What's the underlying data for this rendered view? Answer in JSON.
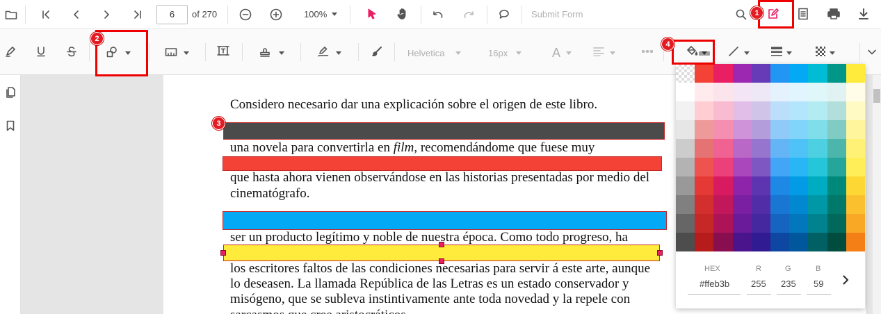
{
  "toolbar": {
    "page_number": "6",
    "page_count": "of 270",
    "zoom": "100%",
    "submit_form": "Submit Form"
  },
  "format_toolbar": {
    "font_family": "Helvetica",
    "font_size": "16px",
    "text_glyph": "A"
  },
  "callouts": [
    "1",
    "2",
    "3",
    "4"
  ],
  "document": {
    "lines": [
      "Considero necesario dar una explicación sobre el origen de este libro.",
      "una novela para convertirla en",
      "film",
      ", recomendándome que fuese muy",
      "que hasta ahora vienen observándose en las historias presentadas por medio del",
      "cinematógrafo.",
      "ser un producto legítimo y noble de nuestra época. Como todo progreso, ha",
      "los escritores faltos de las condiciones necesarias para servir á este arte, aunque",
      "lo deseasen. La llamada República de las Letras es un estado conservador y",
      "misógeno, que se subleva instintivamente ante toda novedad y la repele con",
      "sarcasmos que cree aristocráticos."
    ]
  },
  "annotations": [
    {
      "color": "#4b4b4b",
      "border": "#c62828"
    },
    {
      "color": "#f44336",
      "border": "#c62828"
    },
    {
      "color": "#03a9f4",
      "border": "#c62828"
    },
    {
      "color": "#ffeb3b",
      "border": "#c62828",
      "selected": true
    }
  ],
  "color_picker": {
    "hex_label": "HEX",
    "hex_value": "#ffeb3b",
    "r_label": "R",
    "r_value": "255",
    "g_label": "G",
    "g_value": "235",
    "b_label": "B",
    "b_value": "59",
    "palette": [
      [
        "transparent",
        "#f44336",
        "#e91e63",
        "#9c27b0",
        "#673ab7",
        "#2196f3",
        "#03a9f4",
        "#00bcd4",
        "#009688",
        "#ffeb3b"
      ],
      [
        "#ffffff",
        "#ffebee",
        "#fce4ec",
        "#f3e5f5",
        "#ede7f6",
        "#e3f2fd",
        "#e1f5fe",
        "#e0f7fa",
        "#e0f2f1",
        "#fffde7"
      ],
      [
        "#f2f2f2",
        "#ffcdd2",
        "#f8bbd0",
        "#e1bee7",
        "#d1c4e9",
        "#bbdefb",
        "#b3e5fc",
        "#b2ebf2",
        "#b2dfdb",
        "#fff9c4"
      ],
      [
        "#e6e6e6",
        "#ef9a9a",
        "#f48fb1",
        "#ce93d8",
        "#b39ddb",
        "#90caf9",
        "#81d4fa",
        "#80deea",
        "#80cbc4",
        "#fff59d"
      ],
      [
        "#cccccc",
        "#e57373",
        "#f06292",
        "#ba68c8",
        "#9575cd",
        "#64b5f6",
        "#4fc3f7",
        "#4dd0e1",
        "#4db6ac",
        "#fff176"
      ],
      [
        "#b3b3b3",
        "#ef5350",
        "#ec407a",
        "#ab47bc",
        "#7e57c2",
        "#42a5f5",
        "#29b6f6",
        "#26c6da",
        "#26a69a",
        "#ffee58"
      ],
      [
        "#999999",
        "#e53935",
        "#d81b60",
        "#8e24aa",
        "#5e35b1",
        "#1e88e5",
        "#039be5",
        "#00acc1",
        "#00897b",
        "#fdd835"
      ],
      [
        "#808080",
        "#d32f2f",
        "#c2185b",
        "#7b1fa2",
        "#512da8",
        "#1976d2",
        "#0288d1",
        "#0097a7",
        "#00796b",
        "#fbc02d"
      ],
      [
        "#666666",
        "#c62828",
        "#ad1457",
        "#6a1b9a",
        "#4527a0",
        "#1565c0",
        "#0277bd",
        "#00838f",
        "#00695c",
        "#f9a825"
      ],
      [
        "#4d4d4d",
        "#b71c1c",
        "#880e4f",
        "#4a148c",
        "#311b92",
        "#0d47a1",
        "#01579b",
        "#006064",
        "#004d40",
        "#f57f17"
      ]
    ]
  }
}
